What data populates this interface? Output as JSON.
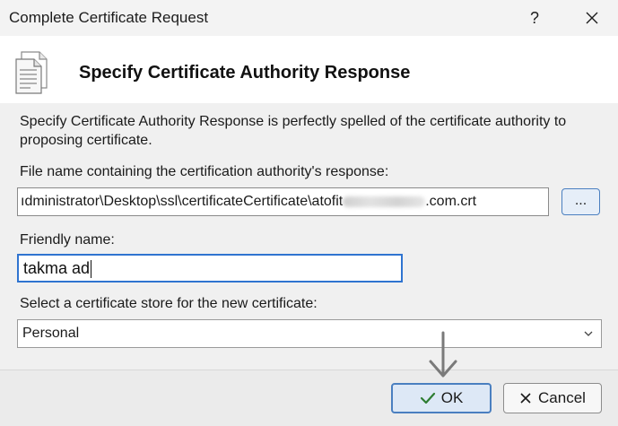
{
  "window": {
    "title": "Complete Certificate Request",
    "help_label": "?"
  },
  "header": {
    "title": "Specify Certificate Authority Response"
  },
  "description": "Specify Certificate Authority Response is  perfectly spelled of the certificate authority to proposing certificate.",
  "file_section": {
    "label": "File name containing the certification authority's response:",
    "value_prefix": "ıdministrator\\Desktop\\ssl\\certificateCertificate\\atofit",
    "value_suffix": ".com.crt",
    "browse_label": "..."
  },
  "friendly_section": {
    "label": "Friendly name:",
    "value": "takma ad"
  },
  "store_section": {
    "label": "Select a certificate store for the new certificate:",
    "selected": "Personal"
  },
  "buttons": {
    "ok_label": "OK",
    "cancel_label": "Cancel"
  },
  "icons": {
    "header": "certificate-document-icon",
    "ok": "checkmark-icon",
    "cancel": "close-icon",
    "annotation": "down-arrow-icon"
  },
  "colors": {
    "accent": "#2f74d0",
    "ok_check": "#2e7d32"
  }
}
